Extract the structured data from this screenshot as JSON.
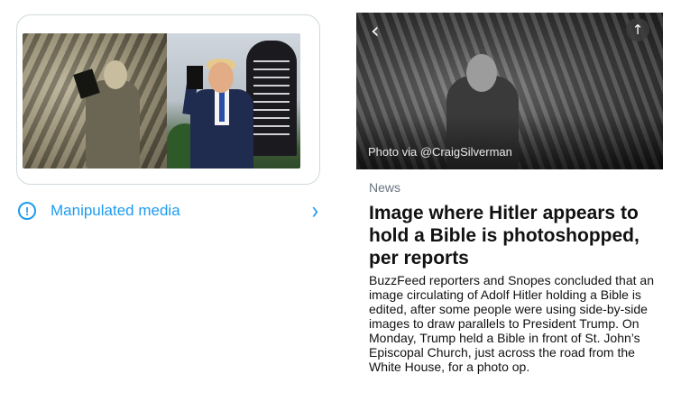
{
  "tweet_card": {
    "image_alt_left": "Hitler holding a book",
    "image_alt_right": "Trump holding a Bible",
    "sign_text": "ST. JOHN'S CHURCH PARISH HOUSE SUNDAY SERVICES ONLINE ALL ARE WELCOME THE REVEREND ROB FISHER, RECT JANE MILLIKEN M WILLIAM HURRI KAVANAGH PE"
  },
  "manipulated": {
    "icon": "info-icon",
    "icon_glyph": "!",
    "label": "Manipulated media",
    "chevron_glyph": "›"
  },
  "accent_color": "#1d9bf0",
  "article": {
    "back_glyph": "‹",
    "share_glyph": "↑",
    "photo_credit": "Photo via @CraigSilverman",
    "section": "News",
    "headline": "Image where Hitler appears to hold a Bible is photoshopped, per reports",
    "body": "BuzzFeed reporters and Snopes concluded that an image circulating of Adolf Hitler holding a Bible is edited, after some people were using side-by-side images to draw parallels to President Trump. On Monday, Trump held a Bible in front of St. John’s Episcopal Church, just across the road from the White House, for a photo op."
  }
}
